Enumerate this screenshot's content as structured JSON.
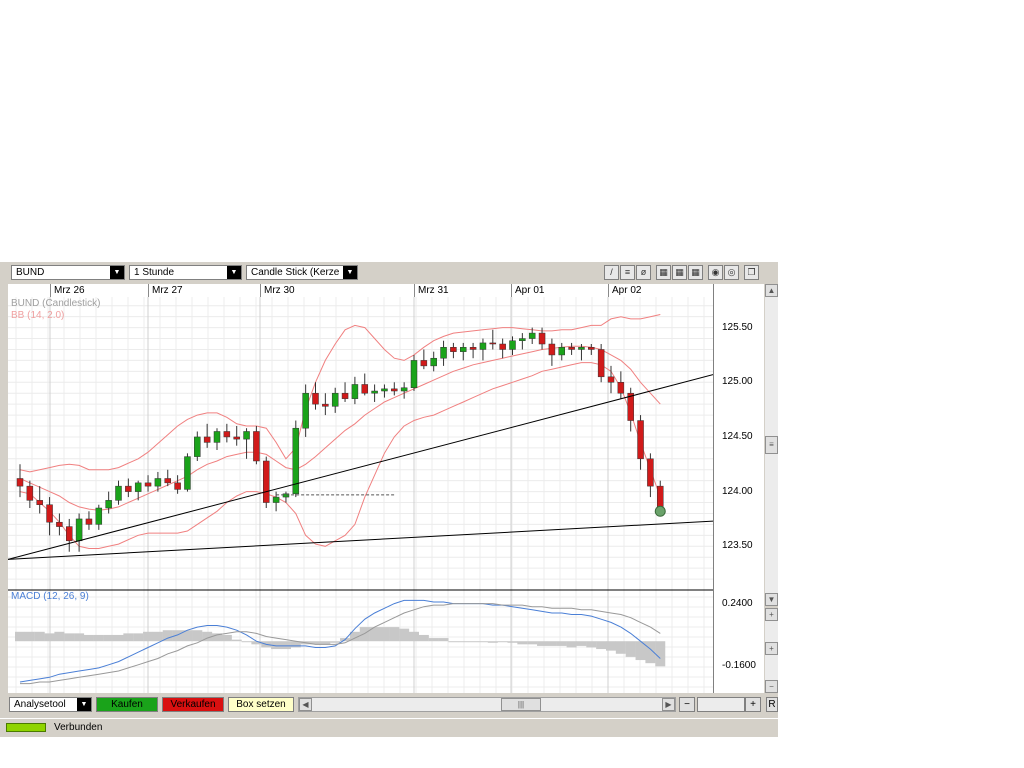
{
  "toolbar": {
    "symbol": "BUND",
    "interval": "1 Stunde",
    "chart_type": "Candle Stick (Kerze",
    "arrow": "▼"
  },
  "dates": [
    "Mrz 26",
    "Mrz 27",
    "Mrz 30",
    "Mrz 31",
    "Apr 01",
    "Apr 02"
  ],
  "price_panel": {
    "label_symbol": "BUND (Candlestick)",
    "label_indicator": "BB (14, 2.0)"
  },
  "macd_panel": {
    "label": "MACD (12, 26, 9)"
  },
  "bottom": {
    "analysis_tool": "Analysetool",
    "buy": "Kaufen",
    "sell": "Verkaufen",
    "box": "Box setzen",
    "right_cut": "R"
  },
  "status": {
    "connection": "Verbunden"
  },
  "colors": {
    "up": "#1aa31a",
    "down": "#d11a1a",
    "bollinger": "#f08080",
    "macd": "#4a7fd6",
    "signal": "#999999",
    "histogram": "#c8c8c8",
    "trendline": "#000000"
  },
  "chart_data": [
    {
      "type": "candlestick",
      "title": "BUND (Candlestick)",
      "indicator": "BB (14, 2.0)",
      "y_ticks": [
        123.5,
        124.0,
        124.5,
        125.0,
        125.5
      ],
      "ylim": [
        123.1,
        125.78
      ],
      "x_labels": [
        "Mrz 26",
        "Mrz 27",
        "Mrz 30",
        "Mrz 31",
        "Apr 01",
        "Apr 02"
      ],
      "ohlc": [
        [
          124.12,
          124.25,
          123.95,
          124.05
        ],
        [
          124.05,
          124.1,
          123.85,
          123.92
        ],
        [
          123.92,
          124.05,
          123.8,
          123.88
        ],
        [
          123.88,
          123.95,
          123.6,
          123.72
        ],
        [
          123.72,
          123.8,
          123.6,
          123.68
        ],
        [
          123.68,
          123.75,
          123.45,
          123.55
        ],
        [
          123.55,
          123.8,
          123.45,
          123.75
        ],
        [
          123.75,
          123.82,
          123.65,
          123.7
        ],
        [
          123.7,
          123.88,
          123.65,
          123.85
        ],
        [
          123.85,
          124.0,
          123.8,
          123.92
        ],
        [
          123.92,
          124.1,
          123.88,
          124.05
        ],
        [
          124.05,
          124.12,
          123.95,
          124.0
        ],
        [
          124.0,
          124.1,
          123.92,
          124.08
        ],
        [
          124.08,
          124.15,
          124.0,
          124.05
        ],
        [
          124.05,
          124.18,
          124.0,
          124.12
        ],
        [
          124.12,
          124.2,
          124.05,
          124.08
        ],
        [
          124.08,
          124.15,
          123.98,
          124.02
        ],
        [
          124.02,
          124.35,
          124.0,
          124.32
        ],
        [
          124.32,
          124.55,
          124.28,
          124.5
        ],
        [
          124.5,
          124.62,
          124.4,
          124.45
        ],
        [
          124.45,
          124.58,
          124.38,
          124.55
        ],
        [
          124.55,
          124.62,
          124.45,
          124.5
        ],
        [
          124.5,
          124.6,
          124.42,
          124.48
        ],
        [
          124.48,
          124.58,
          124.3,
          124.55
        ],
        [
          124.55,
          124.6,
          124.25,
          124.28
        ],
        [
          124.28,
          124.32,
          123.85,
          123.9
        ],
        [
          123.9,
          124.0,
          123.82,
          123.95
        ],
        [
          123.95,
          124.0,
          123.9,
          123.98
        ],
        [
          123.98,
          124.65,
          123.95,
          124.58
        ],
        [
          124.58,
          124.98,
          124.5,
          124.9
        ],
        [
          124.9,
          125.0,
          124.75,
          124.8
        ],
        [
          124.8,
          124.9,
          124.7,
          124.78
        ],
        [
          124.78,
          124.95,
          124.72,
          124.9
        ],
        [
          124.9,
          125.0,
          124.82,
          124.85
        ],
        [
          124.85,
          125.05,
          124.8,
          124.98
        ],
        [
          124.98,
          125.08,
          124.88,
          124.9
        ],
        [
          124.9,
          124.98,
          124.82,
          124.92
        ],
        [
          124.92,
          124.98,
          124.86,
          124.94
        ],
        [
          124.94,
          125.0,
          124.88,
          124.92
        ],
        [
          124.92,
          125.0,
          124.85,
          124.95
        ],
        [
          124.95,
          125.25,
          124.92,
          125.2
        ],
        [
          125.2,
          125.3,
          125.12,
          125.15
        ],
        [
          125.15,
          125.28,
          125.1,
          125.22
        ],
        [
          125.22,
          125.38,
          125.15,
          125.32
        ],
        [
          125.32,
          125.36,
          125.22,
          125.28
        ],
        [
          125.28,
          125.36,
          125.2,
          125.32
        ],
        [
          125.32,
          125.36,
          125.22,
          125.3
        ],
        [
          125.3,
          125.4,
          125.2,
          125.36
        ],
        [
          125.36,
          125.48,
          125.3,
          125.35
        ],
        [
          125.35,
          125.4,
          125.22,
          125.3
        ],
        [
          125.3,
          125.42,
          125.25,
          125.38
        ],
        [
          125.38,
          125.45,
          125.3,
          125.4
        ],
        [
          125.4,
          125.5,
          125.35,
          125.45
        ],
        [
          125.45,
          125.5,
          125.3,
          125.35
        ],
        [
          125.35,
          125.4,
          125.15,
          125.25
        ],
        [
          125.25,
          125.36,
          125.2,
          125.32
        ],
        [
          125.32,
          125.36,
          125.25,
          125.3
        ],
        [
          125.3,
          125.35,
          125.2,
          125.32
        ],
        [
          125.32,
          125.35,
          125.25,
          125.3
        ],
        [
          125.3,
          125.35,
          125.0,
          125.05
        ],
        [
          125.05,
          125.15,
          124.9,
          125.0
        ],
        [
          125.0,
          125.1,
          124.85,
          124.9
        ],
        [
          124.9,
          124.95,
          124.55,
          124.65
        ],
        [
          124.65,
          124.7,
          124.2,
          124.3
        ],
        [
          124.3,
          124.35,
          123.95,
          124.05
        ],
        [
          124.05,
          124.1,
          123.8,
          123.82
        ]
      ],
      "bb_upper": [
        124.2,
        124.18,
        124.2,
        124.22,
        124.24,
        124.25,
        124.24,
        124.2,
        124.2,
        124.2,
        124.22,
        124.26,
        124.3,
        124.36,
        124.44,
        124.52,
        124.6,
        124.66,
        124.7,
        124.72,
        124.72,
        124.68,
        124.62,
        124.6,
        124.6,
        124.58,
        124.45,
        124.3,
        124.4,
        124.75,
        125.0,
        125.2,
        125.35,
        125.48,
        125.52,
        125.5,
        125.4,
        125.3,
        125.22,
        125.2,
        125.25,
        125.32,
        125.38,
        125.42,
        125.45,
        125.46,
        125.47,
        125.48,
        125.49,
        125.5,
        125.5,
        125.49,
        125.48,
        125.47,
        125.47,
        125.48,
        125.48,
        125.5,
        125.52,
        125.52,
        125.58,
        125.6,
        125.58,
        125.58,
        125.6,
        125.62
      ],
      "bb_middle": [
        124.12,
        124.08,
        124.04,
        124.0,
        123.96,
        123.9,
        123.86,
        123.84,
        123.83,
        123.84,
        123.86,
        123.9,
        123.94,
        123.98,
        124.02,
        124.06,
        124.1,
        124.14,
        124.2,
        124.25,
        124.28,
        124.32,
        124.34,
        124.36,
        124.36,
        124.34,
        124.28,
        124.22,
        124.2,
        124.25,
        124.32,
        124.4,
        124.48,
        124.56,
        124.62,
        124.7,
        124.76,
        124.82,
        124.86,
        124.9,
        124.94,
        124.98,
        125.02,
        125.06,
        125.1,
        125.13,
        125.16,
        125.18,
        125.2,
        125.22,
        125.24,
        125.26,
        125.28,
        125.3,
        125.31,
        125.32,
        125.33,
        125.33,
        125.32,
        125.3,
        125.25,
        125.2,
        125.12,
        125.0,
        124.9,
        124.8
      ],
      "bb_lower": [
        124.0,
        123.98,
        123.9,
        123.82,
        123.72,
        123.6,
        123.5,
        123.48,
        123.48,
        123.5,
        123.52,
        123.56,
        123.6,
        123.62,
        123.62,
        123.62,
        123.62,
        123.64,
        123.7,
        123.76,
        123.82,
        123.9,
        123.96,
        124.0,
        124.0,
        123.98,
        123.95,
        123.9,
        123.8,
        123.6,
        123.52,
        123.5,
        123.55,
        123.6,
        123.7,
        123.95,
        124.15,
        124.35,
        124.5,
        124.6,
        124.65,
        124.68,
        124.7,
        124.74,
        124.78,
        124.82,
        124.86,
        124.9,
        124.94,
        124.97,
        125.0,
        125.03,
        125.06,
        125.1,
        125.12,
        125.14,
        125.16,
        125.18,
        125.18,
        125.16,
        125.1,
        124.95,
        124.72,
        124.45,
        124.2,
        123.95
      ],
      "trendlines": [
        {
          "from": [
            0,
            123.38
          ],
          "to": [
            65,
            125.07
          ]
        },
        {
          "from": [
            0,
            123.38
          ],
          "to": [
            65,
            123.73
          ]
        }
      ],
      "horizontal_segment": {
        "from_index": 26,
        "to_index": 38,
        "value": 123.97
      }
    },
    {
      "type": "line",
      "title": "MACD (12, 26, 9)",
      "y_ticks": [
        0.24,
        -0.16
      ],
      "ylim": [
        -0.33,
        0.32
      ],
      "series": [
        {
          "name": "MACD",
          "values": [
            -0.26,
            -0.25,
            -0.24,
            -0.23,
            -0.21,
            -0.2,
            -0.19,
            -0.18,
            -0.17,
            -0.15,
            -0.13,
            -0.1,
            -0.07,
            -0.04,
            -0.01,
            0.02,
            0.04,
            0.07,
            0.09,
            0.1,
            0.1,
            0.09,
            0.07,
            0.04,
            0.0,
            -0.02,
            -0.03,
            -0.03,
            -0.03,
            -0.03,
            -0.04,
            -0.04,
            -0.03,
            0.01,
            0.08,
            0.14,
            0.18,
            0.21,
            0.24,
            0.26,
            0.26,
            0.26,
            0.25,
            0.25,
            0.24,
            0.24,
            0.24,
            0.24,
            0.23,
            0.23,
            0.22,
            0.21,
            0.2,
            0.19,
            0.18,
            0.18,
            0.17,
            0.17,
            0.16,
            0.14,
            0.12,
            0.09,
            0.05,
            0.0,
            -0.05,
            -0.11
          ]
        },
        {
          "name": "Signal",
          "values": [
            -0.27,
            -0.27,
            -0.26,
            -0.26,
            -0.25,
            -0.24,
            -0.23,
            -0.22,
            -0.21,
            -0.2,
            -0.19,
            -0.17,
            -0.15,
            -0.13,
            -0.11,
            -0.08,
            -0.06,
            -0.03,
            -0.01,
            0.02,
            0.04,
            0.05,
            0.06,
            0.06,
            0.05,
            0.03,
            0.02,
            0.01,
            0.0,
            -0.01,
            -0.02,
            -0.02,
            -0.02,
            -0.01,
            0.02,
            0.05,
            0.09,
            0.12,
            0.15,
            0.18,
            0.2,
            0.22,
            0.23,
            0.23,
            0.24,
            0.24,
            0.24,
            0.24,
            0.24,
            0.23,
            0.23,
            0.23,
            0.22,
            0.22,
            0.21,
            0.21,
            0.21,
            0.2,
            0.2,
            0.19,
            0.18,
            0.17,
            0.15,
            0.12,
            0.09,
            0.05
          ]
        }
      ],
      "histogram": [
        0.06,
        0.06,
        0.06,
        0.05,
        0.06,
        0.05,
        0.05,
        0.04,
        0.04,
        0.04,
        0.04,
        0.05,
        0.05,
        0.06,
        0.06,
        0.07,
        0.07,
        0.07,
        0.07,
        0.06,
        0.05,
        0.04,
        0.01,
        0.0,
        -0.02,
        -0.04,
        -0.05,
        -0.05,
        -0.04,
        -0.02,
        -0.02,
        -0.02,
        -0.01,
        0.02,
        0.06,
        0.09,
        0.09,
        0.09,
        0.09,
        0.08,
        0.06,
        0.04,
        0.02,
        0.02,
        0.0,
        0.0,
        0.0,
        0.0,
        -0.01,
        0.0,
        -0.01,
        -0.02,
        -0.02,
        -0.03,
        -0.03,
        -0.03,
        -0.04,
        -0.03,
        -0.04,
        -0.05,
        -0.06,
        -0.08,
        -0.1,
        -0.12,
        -0.14,
        -0.16
      ]
    }
  ]
}
